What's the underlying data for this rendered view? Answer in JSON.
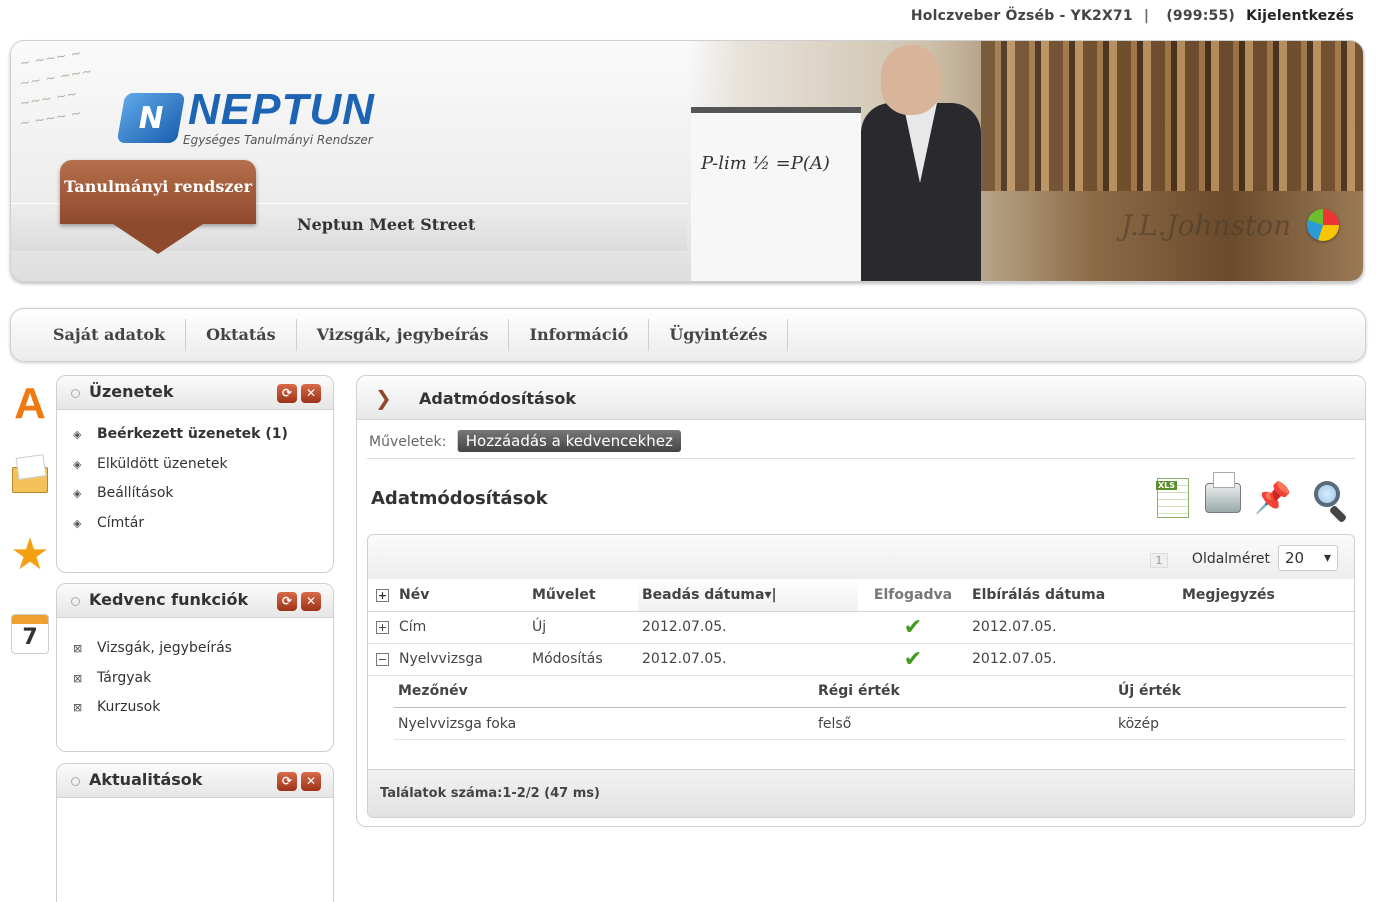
{
  "user": {
    "name": "Holczveber Özséb - YK2X71",
    "separator": "|",
    "timer": "(999:55)",
    "logout": "Kijelentkezés"
  },
  "banner": {
    "logo_title": "NEPTUN",
    "logo_subtitle": "Egységes Tanulmányi Rendszer",
    "tabs": [
      "Tanulmányi rendszer",
      "Neptun Meet Street"
    ],
    "active_tab": "Tanulmányi rendszer"
  },
  "main_nav": [
    "Saját adatok",
    "Oktatás",
    "Vizsgák, jegybeírás",
    "Információ",
    "Ügyintézés"
  ],
  "panels": {
    "messages": {
      "title": "Üzenetek",
      "items": [
        "Beérkezett üzenetek (1)",
        "Elküldött üzenetek",
        "Beállítások",
        "Címtár"
      ]
    },
    "favorites": {
      "title": "Kedvenc funkciók",
      "items": [
        "Vizsgák, jegybeírás",
        "Tárgyak",
        "Kurzusok"
      ]
    },
    "news": {
      "title": "Aktualitások"
    }
  },
  "content": {
    "header_title": "Adatmódosítások",
    "actions_label": "Műveletek:",
    "add_favorite": "Hozzáadás a kedvencekhez",
    "page_title": "Adatmódosítások",
    "pager_current": "1",
    "page_size_label": "Oldalméret",
    "page_size": "20",
    "columns": [
      "Név",
      "Művelet",
      "Beadás dátuma",
      "Elfogadva",
      "Elbírálás dátuma",
      "Megjegyzés"
    ],
    "rows": [
      {
        "name": "Cím",
        "operation": "Új",
        "submitted": "2012.07.05.",
        "accepted": "✔",
        "decided": "2012.07.05.",
        "note": ""
      },
      {
        "name": "Nyelvvizsga",
        "operation": "Módosítás",
        "submitted": "2012.07.05.",
        "accepted": "✔",
        "decided": "2012.07.05.",
        "note": ""
      }
    ],
    "detail": {
      "columns": [
        "Mezőnév",
        "Régi érték",
        "Új érték"
      ],
      "rows": [
        {
          "field": "Nyelvvizsga foka",
          "old": "felső",
          "new": "közép"
        }
      ]
    },
    "footer": "Találatok száma:1-2/2 (47 ms)"
  },
  "icons": {
    "expand": "+",
    "collapse": "−",
    "sort_desc": "▾",
    "refresh": "⟳",
    "close": "✕"
  },
  "colors": {
    "accent_brown": "#8e4a2c",
    "logo_blue": "#1d64b4",
    "check_green": "#3f9a1f"
  }
}
